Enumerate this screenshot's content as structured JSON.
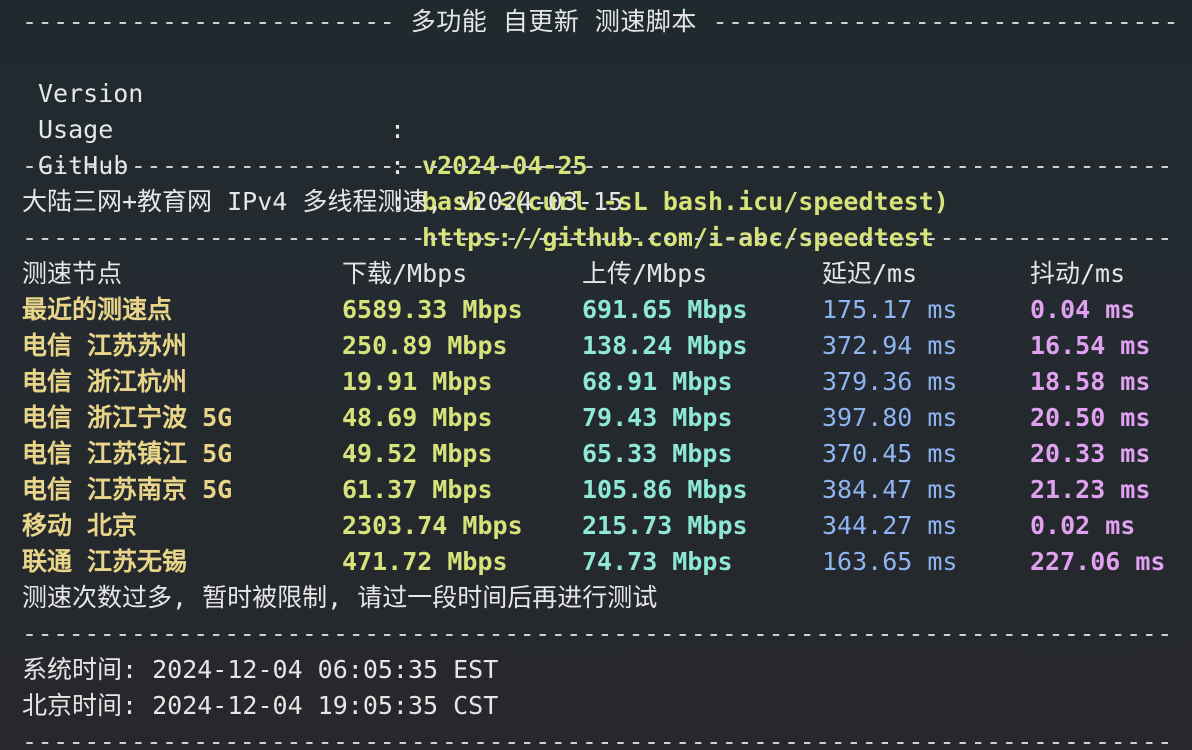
{
  "banner": {
    "title": "多功能 自更新 测速脚本",
    "items": [
      {
        "key": "Version",
        "colon": ":",
        "value": "v2024-04-25"
      },
      {
        "key": "Usage",
        "colon": ":",
        "value": "bash <(curl -sL bash.icu/speedtest)"
      },
      {
        "key": "GitHub",
        "colon": ":",
        "value": "https://github.com/i-abc/speedtest"
      }
    ]
  },
  "section_title": "大陆三网+教育网 IPv4 多线程测速, v2024-03-15",
  "table": {
    "headers": [
      "测速节点",
      "下载/Mbps",
      "上传/Mbps",
      "延迟/ms",
      "抖动/ms"
    ],
    "rows": [
      [
        "最近的测速点",
        "6589.33 Mbps",
        "691.65 Mbps",
        "175.17 ms",
        "0.04 ms"
      ],
      [
        "电信 江苏苏州",
        "250.89 Mbps",
        "138.24 Mbps",
        "372.94 ms",
        "16.54 ms"
      ],
      [
        "电信 浙江杭州",
        "19.91 Mbps",
        "68.91 Mbps",
        "379.36 ms",
        "18.58 ms"
      ],
      [
        "电信 浙江宁波 5G",
        "48.69 Mbps",
        "79.43 Mbps",
        "397.80 ms",
        "20.50 ms"
      ],
      [
        "电信 江苏镇江 5G",
        "49.52 Mbps",
        "65.33 Mbps",
        "370.45 ms",
        "20.33 ms"
      ],
      [
        "电信 江苏南京 5G",
        "61.37 Mbps",
        "105.86 Mbps",
        "384.47 ms",
        "21.23 ms"
      ],
      [
        "移动 北京",
        "2303.74 Mbps",
        "215.73 Mbps",
        "344.27 ms",
        "0.02 ms"
      ],
      [
        "联通 江苏无锡",
        "471.72 Mbps",
        "74.73 Mbps",
        "163.65 ms",
        "227.06 ms"
      ]
    ],
    "notice": "测速次数过多, 暂时被限制, 请过一段时间后再进行测试"
  },
  "times": {
    "system": "系统时间: 2024-12-04 06:05:35 EST",
    "beijing": "北京时间: 2024-12-04 19:05:35 CST"
  },
  "colors": {
    "background": "#252a30",
    "text": "#e6e6e6",
    "node": "#e8d58a",
    "download": "#d7e37a",
    "upload": "#8fe8d6",
    "latency": "#8fb4f2",
    "jitter": "#e0a2f0"
  }
}
